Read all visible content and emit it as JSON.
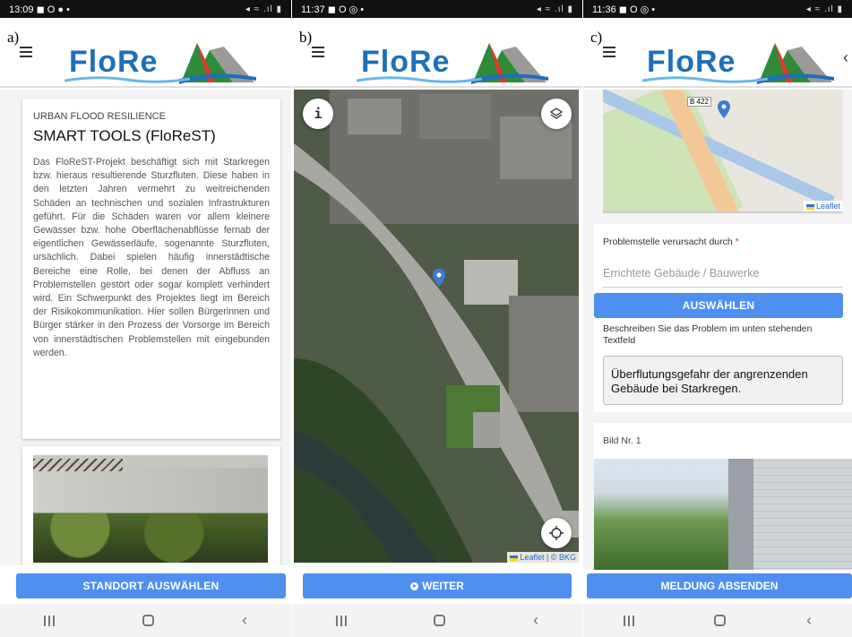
{
  "panels": {
    "a": {
      "letter": "a)",
      "time": "13:09",
      "status_icons": "◼ O ● •",
      "signal": "◂ ≈ .ıl ▮",
      "logo": "FloRe",
      "card_subtitle": "URBAN FLOOD RESILIENCE",
      "card_title": "SMART TOOLS (FloReST)",
      "card_body": "Das FloReST-Projekt beschäftigt sich mit Starkregen bzw. hieraus resultierende Sturzfluten. Diese haben in den letzten Jahren vermehrt zu weitreichenden Schäden an technischen und sozialen Infrastrukturen geführt. Für die Schäden waren vor allem kleinere Gewässer bzw. hohe Oberflächenabflüsse fernab der eigentlichen Gewässerläufe, sogenannte Sturzfluten, ursächlich. Dabei spielen häufig innerstädtische Bereiche eine Rolle, bei denen der Abfluss an Problemstellen gestört oder sogar komplett verhindert wird. Ein Schwerpunkt des Projektes liegt im Bereich der Risikokommunikation. Hier sollen Bürgerinnen und Bürger stärker in den Prozess der Vorsorge im Bereich von innerstädtischen Problemstellen mit eingebunden werden.",
      "button": "STANDORT AUSWÄHLEN"
    },
    "b": {
      "letter": "b)",
      "time": "11:37",
      "status_icons": "◼ O ◎ •",
      "signal": "◂ ≈ .ıl ▮",
      "logo": "FloRe",
      "info_glyph": "i",
      "attribution_leaflet": "Leaflet",
      "attribution_sep": " | © ",
      "attribution_bkg": "BKG",
      "button": "WEITER"
    },
    "c": {
      "letter": "c)",
      "time": "11:36",
      "status_icons": "◼ O ◎ •",
      "signal": "◂ ≈ .ıl ▮",
      "logo": "FloRe",
      "road_label": "B 422",
      "attribution_leaflet": "Leaflet",
      "cause_label": "Problemstelle verursacht durch",
      "required_mark": "*",
      "cause_value": "Errichtete Gebäude / Bauwerke",
      "select_button": "AUSWÄHLEN",
      "description_label": "Beschreiben Sie das Problem im unten stehenden Textfeld",
      "description_value": "Überflutungsgefahr der angrenzenden Gebäude bei Starkregen.",
      "image_label": "Bild Nr. 1",
      "send_button": "MELDUNG ABSENDEN"
    }
  },
  "nav": {
    "back": "‹"
  },
  "icons": {
    "hamburger": "menu-icon",
    "layers": "layers-icon",
    "locate": "crosshair-icon",
    "marker": "map-marker-icon"
  },
  "colors": {
    "primary": "#4e8ff0",
    "logo_blue": "#1e6fb8",
    "required": "#e53935"
  }
}
